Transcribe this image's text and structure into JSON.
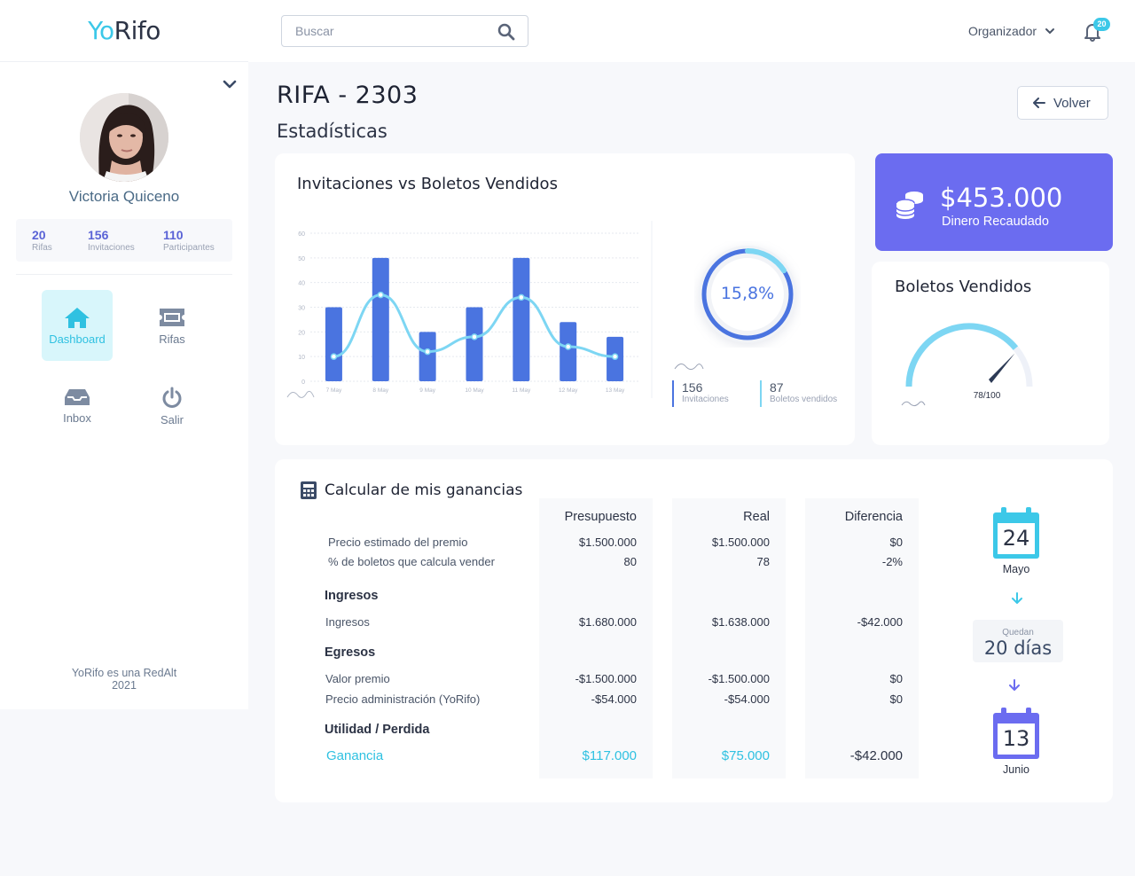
{
  "brand": {
    "logo_yo": "Yo",
    "logo_rifo": "Rifo",
    "accent": "#3cc8e8",
    "primary": "#6b6cf0"
  },
  "sidebar": {
    "user_name": "Victoria Quiceno",
    "stats": [
      {
        "value": "20",
        "label": "Rifas"
      },
      {
        "value": "156",
        "label": "Invitaciones"
      },
      {
        "value": "110",
        "label": "Participantes"
      }
    ],
    "nav": [
      {
        "label": "Dashboard",
        "icon": "home-icon",
        "active": true
      },
      {
        "label": "Rifas",
        "icon": "ticket-icon"
      },
      {
        "label": "Inbox",
        "icon": "inbox-icon"
      },
      {
        "label": "Salir",
        "icon": "power-icon"
      }
    ],
    "footer_line1": "YoRifo es una RedAlt",
    "footer_line2": "2021"
  },
  "topbar": {
    "search_placeholder": "Buscar",
    "role": "Organizador",
    "notifications": "20"
  },
  "page": {
    "title": "RIFA - 2303",
    "subtitle": "Estadísticas",
    "back_label": "Volver"
  },
  "chart_card": {
    "title": "Invitaciones vs Boletos Vendidos",
    "percent": "15,8%",
    "stat1_value": "156",
    "stat1_label": "Invitaciones",
    "stat2_value": "87",
    "stat2_label": "Boletos vendidos"
  },
  "chart_data": {
    "type": "bar",
    "categories": [
      "7 May",
      "8 May",
      "9 May",
      "10 May",
      "11 May",
      "12 May",
      "13 May"
    ],
    "series": [
      {
        "type": "bar",
        "values": [
          30,
          50,
          20,
          30,
          50,
          24,
          18
        ]
      },
      {
        "type": "line",
        "values": [
          10,
          35,
          12,
          18,
          34,
          14,
          10
        ]
      }
    ],
    "yticks": [
      0,
      10,
      20,
      30,
      40,
      50,
      60
    ],
    "ylim": [
      0,
      60
    ],
    "grid": true,
    "donut_percent": 15.8
  },
  "money_card": {
    "value": "$453.000",
    "label": "Dinero Recaudado"
  },
  "boletos_card": {
    "title": "Boletos Vendidos",
    "gauge_label": "78/100",
    "gauge_value": 78,
    "gauge_max": 100
  },
  "calc": {
    "title": "Calcular de mis ganancias",
    "headers": [
      "Presupuesto",
      "Real",
      "Diferencia"
    ],
    "rows_top": [
      {
        "label": "Precio estimado del premio",
        "values": [
          "$1.500.000",
          "$1.500.000",
          "$0"
        ]
      },
      {
        "label": "% de boletos que calcula vender",
        "values": [
          "80",
          "78",
          "-2%"
        ]
      }
    ],
    "sec_ingresos": "Ingresos",
    "rows_ingresos": [
      {
        "label": "Ingresos",
        "values": [
          "$1.680.000",
          "$1.638.000",
          "-$42.000"
        ]
      }
    ],
    "sec_egresos": "Egresos",
    "rows_egresos": [
      {
        "label": "Valor premio",
        "values": [
          "-$1.500.000",
          "-$1.500.000",
          "$0"
        ]
      },
      {
        "label": "Precio administración (YoRifo)",
        "values": [
          "-$54.000",
          "-$54.000",
          "$0"
        ]
      }
    ],
    "sec_utilidad": "Utilidad / Perdida",
    "gain": {
      "label": "Ganancia",
      "values": [
        "$117.000",
        "$75.000",
        "-$42.000"
      ]
    }
  },
  "timeline": {
    "start_day": "24",
    "start_month": "Mayo",
    "quedan_label": "Quedan",
    "quedan_value": "20 días",
    "end_day": "13",
    "end_month": "Junio"
  }
}
